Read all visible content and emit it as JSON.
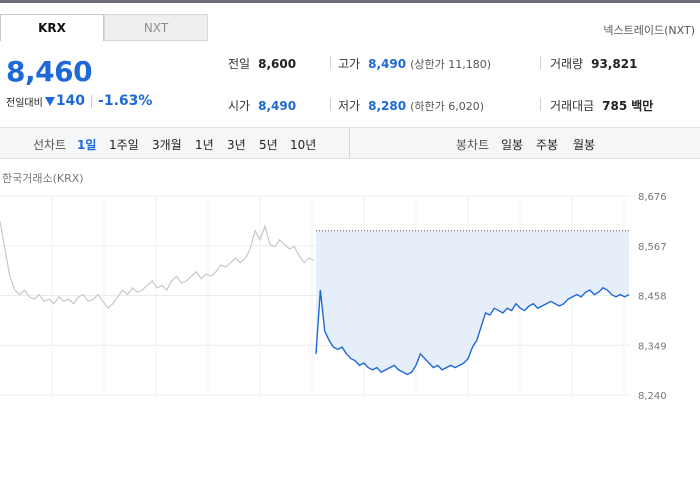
{
  "tabs": [
    {
      "label": "KRX",
      "active": true
    },
    {
      "label": "NXT",
      "active": false
    }
  ],
  "nxt_link": "넥스트레이드(NXT)",
  "quote": {
    "price": "8,460",
    "change_label": "전일대비",
    "change_abs": "140",
    "change_pct": "-1.63%",
    "direction": "down"
  },
  "stats": {
    "prev_close": {
      "label": "전일",
      "value": "8,600"
    },
    "high": {
      "label": "고가",
      "value": "8,490",
      "sub": "(상한가 11,180)"
    },
    "volume": {
      "label": "거래량",
      "value": "93,821"
    },
    "open": {
      "label": "시가",
      "value": "8,490"
    },
    "low": {
      "label": "저가",
      "value": "8,280",
      "sub": "(하한가 6,020)"
    },
    "amount": {
      "label": "거래대금",
      "value": "785",
      "unit": "백만"
    }
  },
  "toolbar": {
    "line_label": "선차트",
    "line_periods": [
      "1일",
      "1주일",
      "3개월",
      "1년",
      "3년",
      "5년",
      "10년"
    ],
    "selected_period": "1일",
    "candle_label": "봉차트",
    "candle_periods": [
      "일봉",
      "주봉",
      "월봉"
    ]
  },
  "chart_caption": "한국거래소(KRX)",
  "colors": {
    "accent_blue": "#1e68d8",
    "prev_day_line": "#c8c8c8",
    "fill": "#e6eefa"
  },
  "chart_data": {
    "type": "line",
    "y_ticks": [
      "8,676",
      "8,567",
      "8,458",
      "8,349",
      "8,240"
    ],
    "ylim": [
      8240,
      8676
    ],
    "grid": true,
    "reference_line": 8600,
    "series": [
      {
        "role": "previous_day",
        "values": [
          8620,
          8560,
          8500,
          8470,
          8460,
          8470,
          8455,
          8450,
          8460,
          8445,
          8450,
          8440,
          8455,
          8445,
          8450,
          8440,
          8455,
          8460,
          8445,
          8450,
          8460,
          8445,
          8430,
          8440,
          8455,
          8470,
          8460,
          8475,
          8465,
          8470,
          8480,
          8490,
          8475,
          8480,
          8470,
          8490,
          8500,
          8485,
          8490,
          8500,
          8510,
          8495,
          8505,
          8500,
          8510,
          8525,
          8520,
          8530,
          8540,
          8530,
          8540,
          8560,
          8600,
          8580,
          8610,
          8570,
          8565,
          8580,
          8570,
          8560,
          8565,
          8545,
          8530,
          8540,
          8535
        ]
      },
      {
        "role": "today",
        "values": [
          8330,
          8470,
          8380,
          8360,
          8345,
          8340,
          8345,
          8330,
          8320,
          8315,
          8305,
          8310,
          8300,
          8295,
          8300,
          8290,
          8295,
          8300,
          8305,
          8295,
          8290,
          8285,
          8290,
          8305,
          8330,
          8320,
          8310,
          8300,
          8305,
          8295,
          8300,
          8305,
          8300,
          8305,
          8310,
          8320,
          8345,
          8360,
          8390,
          8420,
          8415,
          8430,
          8425,
          8420,
          8430,
          8425,
          8440,
          8430,
          8425,
          8435,
          8440,
          8430,
          8435,
          8440,
          8445,
          8440,
          8435,
          8440,
          8450,
          8455,
          8460,
          8455,
          8465,
          8470,
          8460,
          8465,
          8475,
          8470,
          8460,
          8455,
          8460,
          8455,
          8460
        ]
      }
    ]
  }
}
